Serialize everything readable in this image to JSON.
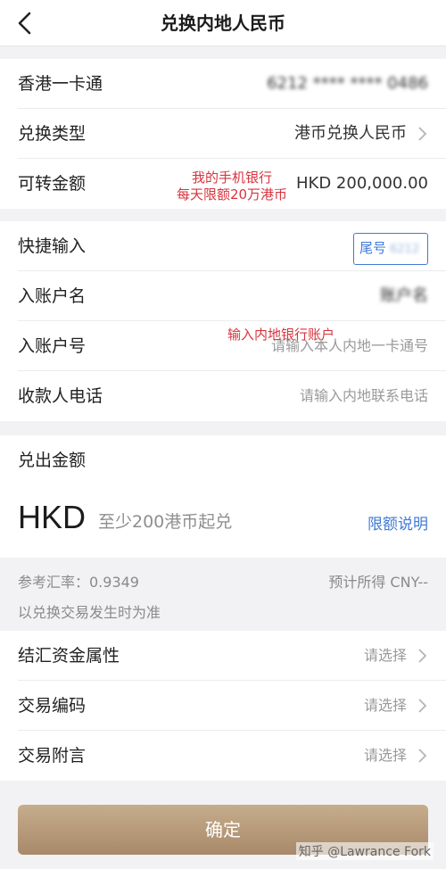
{
  "header": {
    "title": "兑换内地人民币"
  },
  "card_section": {
    "card_label": "香港一卡通",
    "card_number_masked": "6212 **** **** 0486",
    "exchange_type_label": "兑换类型",
    "exchange_type_value": "港币兑换人民币",
    "available_label": "可转金额",
    "available_value": "HKD 200,000.00",
    "annotation_limit": [
      "我的手机银行",
      "每天限额20万港币"
    ]
  },
  "payee_section": {
    "quick_input_label": "快捷输入",
    "tail_number_button": "尾号",
    "tail_number_masked": "6212",
    "account_name_label": "入账户名",
    "account_name_masked": "账户名",
    "account_number_label": "入账户号",
    "account_number_placeholder": "请输入本人内地一卡通号",
    "annotation_account": "输入内地银行账户",
    "phone_label": "收款人电话",
    "phone_placeholder": "请输入内地联系电话"
  },
  "amount_section": {
    "label": "兑出金额",
    "currency": "HKD",
    "input_placeholder": "至少200港币起兑",
    "limit_link": "限额说明"
  },
  "rate": {
    "reference_label": "参考汇率：0.9349",
    "estimate_label": "预计所得 CNY--",
    "note": "以兑换交易发生时为准"
  },
  "extra_section": {
    "fund_attr_label": "结汇资金属性",
    "fund_attr_placeholder": "请选择",
    "txn_code_label": "交易编码",
    "txn_code_placeholder": "请选择",
    "txn_note_label": "交易附言",
    "txn_note_placeholder": "请选择"
  },
  "confirm_button": "确定",
  "watermark": "知乎 @Lawrance Fork",
  "colors": {
    "accent_blue": "#3f7ad6",
    "annotation_red": "#d8343e",
    "confirm_gold": "#b89a7a"
  }
}
